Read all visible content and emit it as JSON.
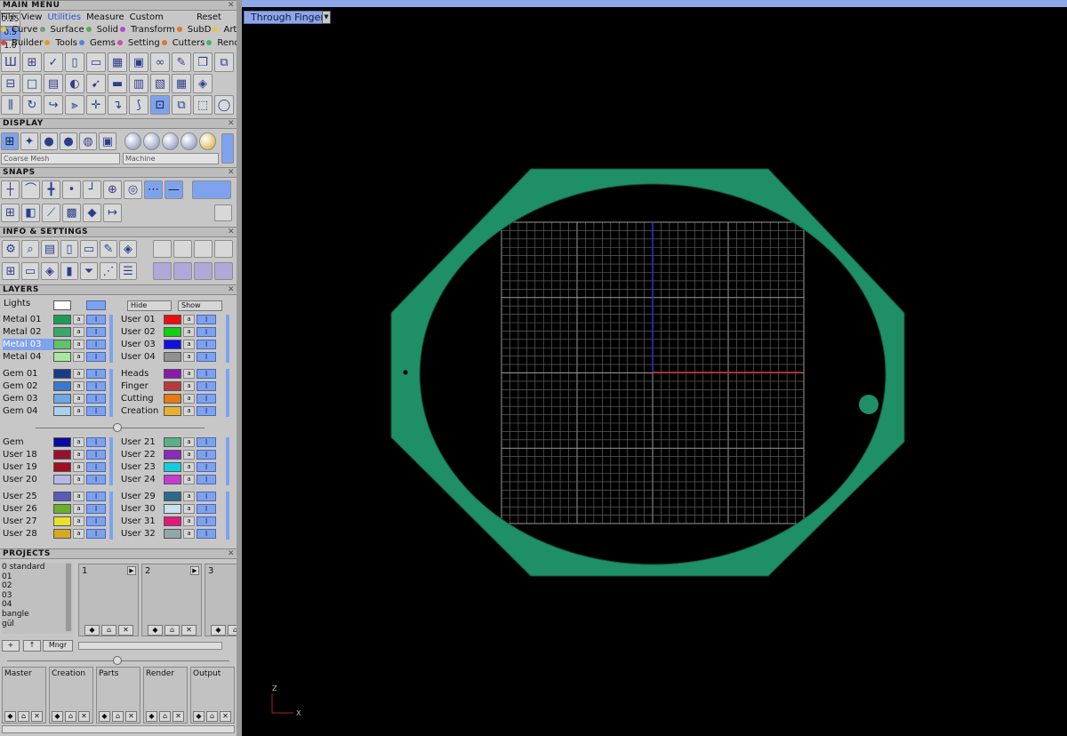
{
  "main_menu": {
    "title": "MAIN MENU",
    "menubar": [
      "File",
      "View",
      "Utilities",
      "Measure",
      "Custom"
    ],
    "reset": "Reset",
    "row1": [
      {
        "label": "Curve",
        "color": "#e8c64a"
      },
      {
        "label": "Surface",
        "color": "#6aa37a"
      },
      {
        "label": "Solid",
        "color": "#4fb34f"
      },
      {
        "label": "Transform",
        "color": "#b44ad0"
      },
      {
        "label": "SubD",
        "color": "#e07a2a"
      },
      {
        "label": "Art",
        "color": "#e0c84a"
      }
    ],
    "row2": [
      {
        "label": "Builder",
        "color": "#d04a4a"
      },
      {
        "label": "Tools",
        "color": "#e09a2a"
      },
      {
        "label": "Gems",
        "color": "#4a8ae0"
      },
      {
        "label": "Setting",
        "color": "#d04ab0"
      },
      {
        "label": "Cutters",
        "color": "#e07a2a"
      },
      {
        "label": "Render",
        "color": "#4ab06a"
      }
    ],
    "icons_row1": [
      "ruler-icon",
      "grid-icon",
      "check-icon",
      "page-icon",
      "page2-icon",
      "calendar-icon",
      "frame-icon",
      "link-icon",
      "brush-icon",
      "copy-icon",
      "clone-icon"
    ],
    "icons_row2": [
      "dimension-icon",
      "box-icon",
      "pattern-icon",
      "half-icon",
      "run-icon",
      "ground-icon",
      "table-icon",
      "book-icon",
      "grid2-icon",
      "cube-icon"
    ],
    "icons_row3": [
      "split-icon",
      "rotate-icon",
      "curve-tool-icon",
      "mirror-icon",
      "move-icon",
      "pivot-icon",
      "bend-icon",
      "robot-icon",
      "pages-icon",
      "cursor-icon",
      "ring-icon"
    ]
  },
  "display": {
    "title": "DISPLAY",
    "mesh_select": "Coarse Mesh",
    "material_select": "Machine"
  },
  "snaps": {
    "title": "SNAPS",
    "values": [
      "0.1",
      "0.25",
      "0.5",
      "1.0"
    ]
  },
  "info": {
    "title": "INFO & SETTINGS"
  },
  "layers": {
    "title": "LAYERS",
    "lights_label": "Lights",
    "hide_label": "Hide",
    "show_label": "Show",
    "left_groups": [
      [
        {
          "name": "Metal 01",
          "color": "#1f9a5a"
        },
        {
          "name": "Metal 02",
          "color": "#3aa86a"
        },
        {
          "name": "Metal 03",
          "color": "#5ec46a",
          "selected": true
        },
        {
          "name": "Metal 04",
          "color": "#a8e8a0"
        }
      ],
      [
        {
          "name": "Gem 01",
          "color": "#1a3a8a"
        },
        {
          "name": "Gem 02",
          "color": "#3a78d0"
        },
        {
          "name": "Gem 03",
          "color": "#6aa8e8"
        },
        {
          "name": "Gem 04",
          "color": "#a8d0f0"
        }
      ],
      [
        {
          "name": "Gem",
          "color": "#0a0aa0"
        },
        {
          "name": "User 18",
          "color": "#9a1030"
        },
        {
          "name": "User 19",
          "color": "#a01020"
        },
        {
          "name": "User 20",
          "color": "#b8b8e8"
        }
      ],
      [
        {
          "name": "User 25",
          "color": "#5a5ab8"
        },
        {
          "name": "User 26",
          "color": "#6ab02a"
        },
        {
          "name": "User 27",
          "color": "#e8e02a"
        },
        {
          "name": "User 28",
          "color": "#d8a820"
        }
      ]
    ],
    "right_groups": [
      [
        {
          "name": "User 01",
          "color": "#e81010"
        },
        {
          "name": "User 02",
          "color": "#10d010"
        },
        {
          "name": "User 03",
          "color": "#1010e0"
        },
        {
          "name": "User 04",
          "color": "#909090"
        }
      ],
      [
        {
          "name": "Heads",
          "color": "#8a1aa8"
        },
        {
          "name": "Finger",
          "color": "#b83a3a"
        },
        {
          "name": "Cutting",
          "color": "#e87a10"
        },
        {
          "name": "Creation",
          "color": "#e8b030"
        }
      ],
      [
        {
          "name": "User 21",
          "color": "#5ab08a"
        },
        {
          "name": "User 22",
          "color": "#8a2ab8"
        },
        {
          "name": "User 23",
          "color": "#10d0e0"
        },
        {
          "name": "User 24",
          "color": "#c83ad0"
        }
      ],
      [
        {
          "name": "User 29",
          "color": "#2a6a8a"
        },
        {
          "name": "User 30",
          "color": "#c8e0f0"
        },
        {
          "name": "User 31",
          "color": "#e01a7a"
        },
        {
          "name": "User 32",
          "color": "#90a8a8"
        }
      ]
    ]
  },
  "projects": {
    "title": "PROJECTS",
    "list": [
      "0 standard",
      "01",
      "02",
      "03",
      "04",
      "bangle",
      "gül"
    ],
    "slots": [
      "1",
      "2",
      "3"
    ],
    "mngr": "Mngr",
    "outputs": [
      "Master",
      "Creation",
      "Parts",
      "Render",
      "Output"
    ]
  },
  "viewport": {
    "view_label": "Through Finger",
    "axis_z": "Z",
    "axis_x": "X",
    "ring_color": "#1e8f66",
    "grid_color": "#6e6e6e"
  }
}
